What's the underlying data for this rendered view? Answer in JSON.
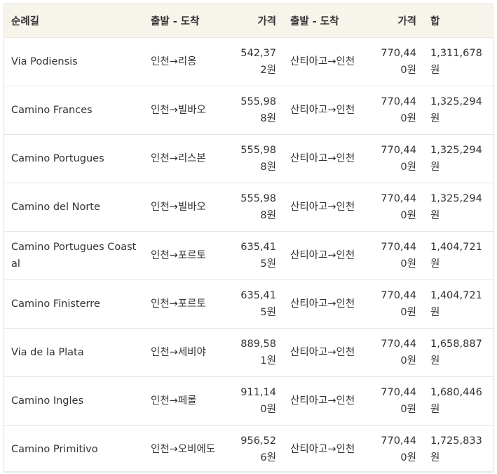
{
  "table": {
    "headers": {
      "route": "순례길",
      "out_leg": "출발 - 도착",
      "out_price": "가격",
      "return_leg": "출발 - 도착",
      "return_price": "가격",
      "total": "합"
    },
    "rows": [
      {
        "route": "Via Podiensis",
        "out_leg": "인천→리옹",
        "out_price": "542,372원",
        "return_leg": "산티아고→인천",
        "return_price": "770,440원",
        "total": "1,311,678원"
      },
      {
        "route": "Camino Frances",
        "out_leg": "인천→빌바오",
        "out_price": "555,988원",
        "return_leg": "산티아고→인천",
        "return_price": "770,440원",
        "total": "1,325,294원"
      },
      {
        "route": "Camino Portugues",
        "out_leg": "인천→리스본",
        "out_price": "555,988원",
        "return_leg": "산티아고→인천",
        "return_price": "770,440원",
        "total": "1,325,294원"
      },
      {
        "route": "Camino del Norte",
        "out_leg": "인천→빌바오",
        "out_price": "555,988원",
        "return_leg": "산티아고→인천",
        "return_price": "770,440원",
        "total": "1,325,294원"
      },
      {
        "route": "Camino Portugues Coastal",
        "out_leg": "인천→포르토",
        "out_price": "635,415원",
        "return_leg": "산티아고→인천",
        "return_price": "770,440원",
        "total": "1,404,721원"
      },
      {
        "route": "Camino Finisterre",
        "out_leg": "인천→포르토",
        "out_price": "635,415원",
        "return_leg": "산티아고→인천",
        "return_price": "770,440원",
        "total": "1,404,721원"
      },
      {
        "route": "Via de la Plata",
        "out_leg": "인천→세비야",
        "out_price": "889,581원",
        "return_leg": "산티아고→인천",
        "return_price": "770,440원",
        "total": "1,658,887원"
      },
      {
        "route": "Camino Ingles",
        "out_leg": "인천→페롤",
        "out_price": "911,140원",
        "return_leg": "산티아고→인천",
        "return_price": "770,440원",
        "total": "1,680,446원"
      },
      {
        "route": "Camino Primitivo",
        "out_leg": "인천→오비에도",
        "out_price": "956,526원",
        "return_leg": "산티아고→인천",
        "return_price": "770,440원",
        "total": "1,725,833원"
      }
    ]
  }
}
